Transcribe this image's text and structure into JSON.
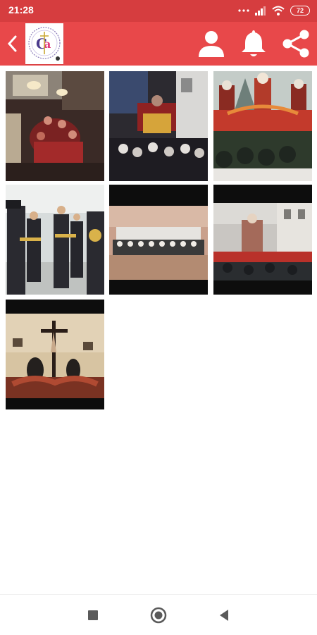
{
  "status_bar": {
    "time": "21:28",
    "battery_level": "72",
    "icons": [
      "more-dots-icon",
      "signal-icon",
      "wifi-icon",
      "battery-icon"
    ]
  },
  "app_bar": {
    "background": "#e8484a",
    "actions": [
      "back-icon",
      "profile-icon",
      "bell-icon",
      "share-icon"
    ]
  },
  "gallery": {
    "photos": [
      {
        "name": "photo-1",
        "subject": "procession-night"
      },
      {
        "name": "photo-2",
        "subject": "procession-float-crowd"
      },
      {
        "name": "photo-3",
        "subject": "float-with-statues"
      },
      {
        "name": "photo-4",
        "subject": "marching-band"
      },
      {
        "name": "photo-5",
        "subject": "group-photo"
      },
      {
        "name": "photo-6",
        "subject": "float-in-street"
      },
      {
        "name": "photo-7",
        "subject": "crucifix-altar"
      }
    ]
  },
  "nav_bar": {
    "buttons": [
      "recents-icon",
      "home-icon",
      "back-nav-icon"
    ]
  },
  "colors": {
    "status_bar": "#d63d3f",
    "app_bar": "#e8484a",
    "background": "#ffffff"
  }
}
